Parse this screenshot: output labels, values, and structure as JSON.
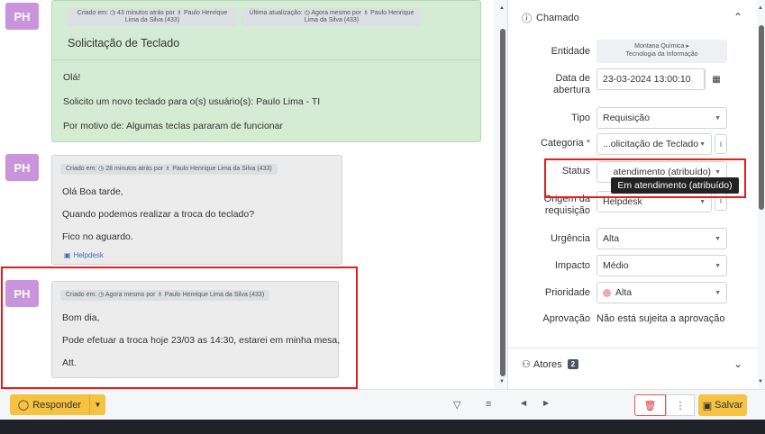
{
  "timeline": {
    "ticket": {
      "avatar": "PH",
      "created_meta": "Criado em: ◷ 43 minutos atrás por ♗ Paulo Henrique Lima da Silva (433)",
      "updated_meta": "Última atualização: ◷ Agora mesmo por ♗ Paulo Henrique Lima da Silva (433)",
      "title": "Solicitação de Teclado",
      "lines": [
        "Olá!",
        "Solicito um novo teclado para o(s) usuário(s): Paulo Lima - TI",
        "Por motivo de: Algumas teclas pararam de funcionar"
      ]
    },
    "followup1": {
      "avatar": "PH",
      "meta": "Criado em: ◷ 28 minutos atrás por ♗ Paulo Henrique Lima da Silva (433)",
      "lines": [
        "Olá Boa tarde,",
        "Quando podemos realizar a troca do teclado?",
        "Fico no aguardo."
      ],
      "source": "Helpdesk"
    },
    "followup2": {
      "avatar": "PH",
      "meta": "Criado em: ◷ Agora mesmo por ♗ Paulo Henrique Lima da Silva (433)",
      "lines": [
        "Bom dia,",
        "Pode efetuar a troca hoje 23/03 as 14:30, estarei em minha mesa,",
        "Att."
      ]
    }
  },
  "panel": {
    "section_title": "Chamado",
    "entity_label": "Entidade",
    "entity_line1": "Montana Química ▸",
    "entity_line2": "Tecnologia da Informação",
    "date_label_1": "Data de",
    "date_label_2": "abertura",
    "date_value": "23-03-2024 13:00:10",
    "type_label": "Tipo",
    "type_value": "Requisição",
    "category_label": "Categoria",
    "required_mark": "*",
    "category_value": "...olicitação de Teclado",
    "status_label": "Status",
    "status_value": "atendimento (atribuído)",
    "status_tooltip": "Em atendimento (atribuído)",
    "origin_label_1": "Origem da",
    "origin_label_2": "requisição",
    "origin_value": "Helpdesk",
    "urgency_label": "Urgência",
    "urgency_value": "Alta",
    "impact_label": "Impacto",
    "impact_value": "Médio",
    "priority_label": "Prioridade",
    "priority_value": "Alta",
    "approval_label": "Aprovação",
    "approval_value": "Não está sujeita a aprovação",
    "actors_label": "Atores",
    "actors_count": "2"
  },
  "bottom": {
    "respond_label": "Responder",
    "save_label": "Salvar"
  },
  "colors": {
    "accent": "#f5c242",
    "avatar": "#c994dc",
    "ticket_bg": "#d4ecd3",
    "highlight": "#e11d1d"
  }
}
